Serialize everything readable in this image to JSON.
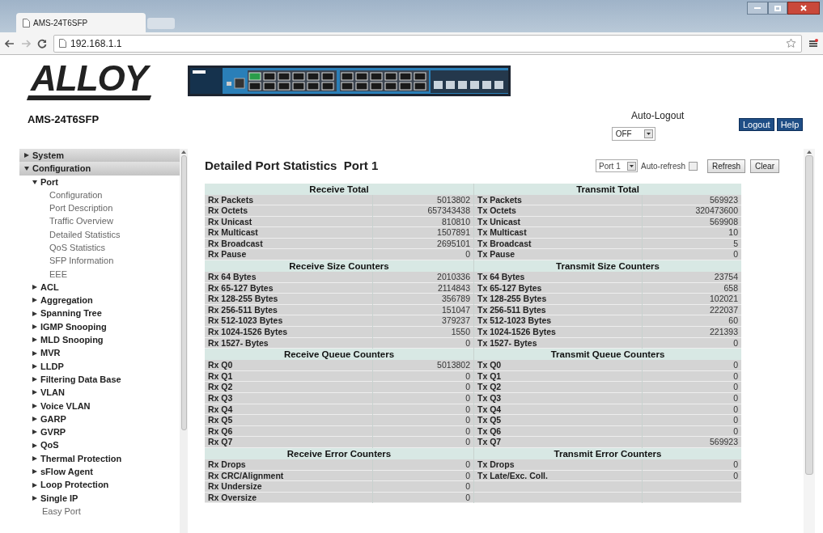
{
  "browser": {
    "tab_title": "AMS-24T6SFP",
    "url": "192.168.1.1"
  },
  "header": {
    "logo": "ALLOY",
    "model": "AMS-24T6SFP",
    "auto_logout": {
      "label": "Auto-Logout",
      "value": "OFF"
    },
    "buttons": [
      "Logout",
      "Help"
    ]
  },
  "sidebar": {
    "items": [
      {
        "label": "System",
        "kind": "group",
        "expanded": false
      },
      {
        "label": "Configuration",
        "kind": "group",
        "expanded": true,
        "children": [
          {
            "label": "Port",
            "kind": "group",
            "expanded": true,
            "children": [
              {
                "label": "Configuration",
                "kind": "page"
              },
              {
                "label": "Port Description",
                "kind": "page"
              },
              {
                "label": "Traffic Overview",
                "kind": "page"
              },
              {
                "label": "Detailed Statistics",
                "kind": "page"
              },
              {
                "label": "QoS Statistics",
                "kind": "page"
              },
              {
                "label": "SFP Information",
                "kind": "page"
              },
              {
                "label": "EEE",
                "kind": "page"
              }
            ]
          },
          {
            "label": "ACL",
            "kind": "group",
            "expanded": false
          },
          {
            "label": "Aggregation",
            "kind": "group",
            "expanded": false
          },
          {
            "label": "Spanning Tree",
            "kind": "group",
            "expanded": false
          },
          {
            "label": "IGMP Snooping",
            "kind": "group",
            "expanded": false
          },
          {
            "label": "MLD Snooping",
            "kind": "group",
            "expanded": false
          },
          {
            "label": "MVR",
            "kind": "group",
            "expanded": false
          },
          {
            "label": "LLDP",
            "kind": "group",
            "expanded": false
          },
          {
            "label": "Filtering Data Base",
            "kind": "group",
            "expanded": false
          },
          {
            "label": "VLAN",
            "kind": "group",
            "expanded": false
          },
          {
            "label": "Voice VLAN",
            "kind": "group",
            "expanded": false
          },
          {
            "label": "GARP",
            "kind": "group",
            "expanded": false
          },
          {
            "label": "GVRP",
            "kind": "group",
            "expanded": false
          },
          {
            "label": "QoS",
            "kind": "group",
            "expanded": false
          },
          {
            "label": "Thermal Protection",
            "kind": "group",
            "expanded": false
          },
          {
            "label": "sFlow Agent",
            "kind": "group",
            "expanded": false
          },
          {
            "label": "Loop Protection",
            "kind": "group",
            "expanded": false
          },
          {
            "label": "Single IP",
            "kind": "group",
            "expanded": false
          },
          {
            "label": "Easy Port",
            "kind": "page"
          }
        ]
      }
    ]
  },
  "main": {
    "title": "Detailed Port Statistics  Port 1",
    "port_select": "Port 1",
    "auto_refresh": {
      "label": "Auto-refresh",
      "checked": false
    },
    "buttons": [
      "Refresh",
      "Clear"
    ],
    "sections": [
      {
        "rx": {
          "title": "Receive Total",
          "rows": [
            {
              "label": "Rx Packets",
              "value": "5013802"
            },
            {
              "label": "Rx Octets",
              "value": "657343438"
            },
            {
              "label": "Rx Unicast",
              "value": "810810"
            },
            {
              "label": "Rx Multicast",
              "value": "1507891"
            },
            {
              "label": "Rx Broadcast",
              "value": "2695101"
            },
            {
              "label": "Rx Pause",
              "value": "0"
            }
          ]
        },
        "tx": {
          "title": "Transmit Total",
          "rows": [
            {
              "label": "Tx Packets",
              "value": "569923"
            },
            {
              "label": "Tx Octets",
              "value": "320473600"
            },
            {
              "label": "Tx Unicast",
              "value": "569908"
            },
            {
              "label": "Tx Multicast",
              "value": "10"
            },
            {
              "label": "Tx Broadcast",
              "value": "5"
            },
            {
              "label": "Tx Pause",
              "value": "0"
            }
          ]
        }
      },
      {
        "rx": {
          "title": "Receive Size Counters",
          "rows": [
            {
              "label": "Rx 64 Bytes",
              "value": "2010336"
            },
            {
              "label": "Rx 65-127 Bytes",
              "value": "2114843"
            },
            {
              "label": "Rx 128-255 Bytes",
              "value": "356789"
            },
            {
              "label": "Rx 256-511 Bytes",
              "value": "151047"
            },
            {
              "label": "Rx 512-1023 Bytes",
              "value": "379237"
            },
            {
              "label": "Rx 1024-1526 Bytes",
              "value": "1550"
            },
            {
              "label": "Rx 1527- Bytes",
              "value": "0"
            }
          ]
        },
        "tx": {
          "title": "Transmit Size Counters",
          "rows": [
            {
              "label": "Tx 64 Bytes",
              "value": "23754"
            },
            {
              "label": "Tx 65-127 Bytes",
              "value": "658"
            },
            {
              "label": "Tx 128-255 Bytes",
              "value": "102021"
            },
            {
              "label": "Tx 256-511 Bytes",
              "value": "222037"
            },
            {
              "label": "Tx 512-1023 Bytes",
              "value": "60"
            },
            {
              "label": "Tx 1024-1526 Bytes",
              "value": "221393"
            },
            {
              "label": "Tx 1527- Bytes",
              "value": "0"
            }
          ]
        }
      },
      {
        "rx": {
          "title": "Receive Queue Counters",
          "rows": [
            {
              "label": "Rx Q0",
              "value": "5013802"
            },
            {
              "label": "Rx Q1",
              "value": "0"
            },
            {
              "label": "Rx Q2",
              "value": "0"
            },
            {
              "label": "Rx Q3",
              "value": "0"
            },
            {
              "label": "Rx Q4",
              "value": "0"
            },
            {
              "label": "Rx Q5",
              "value": "0"
            },
            {
              "label": "Rx Q6",
              "value": "0"
            },
            {
              "label": "Rx Q7",
              "value": "0"
            }
          ]
        },
        "tx": {
          "title": "Transmit Queue Counters",
          "rows": [
            {
              "label": "Tx Q0",
              "value": "0"
            },
            {
              "label": "Tx Q1",
              "value": "0"
            },
            {
              "label": "Tx Q2",
              "value": "0"
            },
            {
              "label": "Tx Q3",
              "value": "0"
            },
            {
              "label": "Tx Q4",
              "value": "0"
            },
            {
              "label": "Tx Q5",
              "value": "0"
            },
            {
              "label": "Tx Q6",
              "value": "0"
            },
            {
              "label": "Tx Q7",
              "value": "569923"
            }
          ]
        }
      },
      {
        "rx": {
          "title": "Receive Error Counters",
          "rows": [
            {
              "label": "Rx Drops",
              "value": "0"
            },
            {
              "label": "Rx CRC/Alignment",
              "value": "0"
            },
            {
              "label": "Rx Undersize",
              "value": "0"
            },
            {
              "label": "Rx Oversize",
              "value": "0"
            }
          ]
        },
        "tx": {
          "title": "Transmit Error Counters",
          "rows": [
            {
              "label": "Tx Drops",
              "value": "0"
            },
            {
              "label": "Tx Late/Exc. Coll.",
              "value": "0"
            }
          ]
        }
      }
    ]
  }
}
